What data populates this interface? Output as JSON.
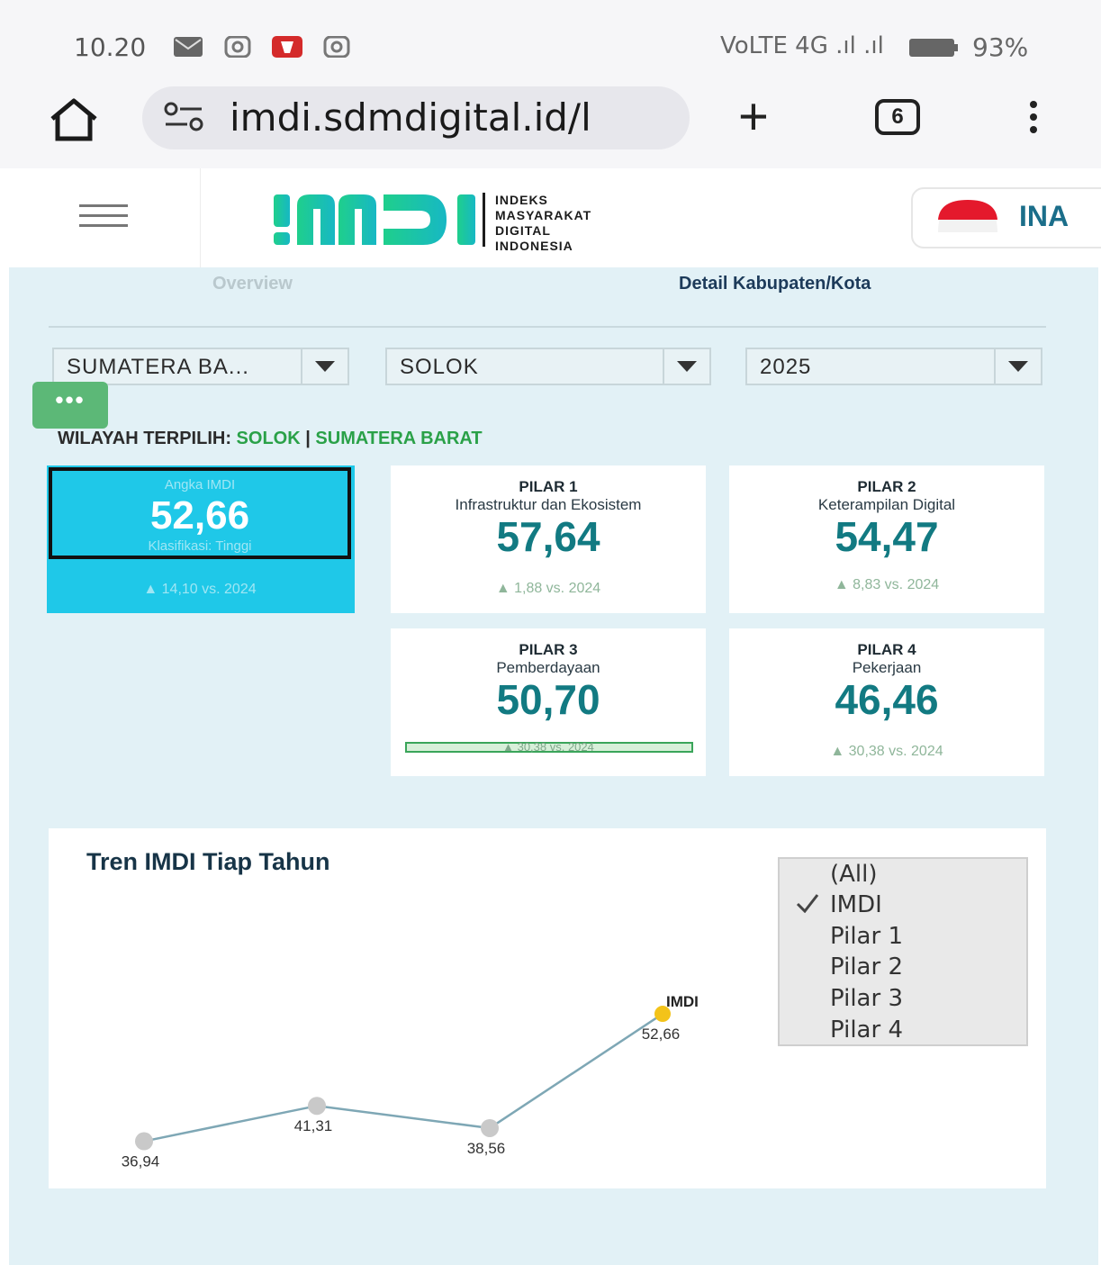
{
  "status_bar": {
    "time": "10.20",
    "signal_text": "VoLTE 4G .ıl .ıl",
    "battery_percent": "93%",
    "icons": [
      "mail-icon",
      "instagram-icon",
      "app-notification-icon",
      "instagram-icon",
      "volte-icon",
      "signal-icon",
      "battery-icon"
    ]
  },
  "browser": {
    "url": "imdi.sdmdigital.id/l",
    "open_tabs_count": "6",
    "icons": [
      "home-icon",
      "site-settings-icon",
      "new-tab-icon",
      "tabs-icon",
      "menu-icon"
    ]
  },
  "site_header": {
    "logo_text": "IMDI",
    "logo_tagline": [
      "INDEKS",
      "MASYARAKAT",
      "DIGITAL",
      "INDONESIA"
    ],
    "language": "INA",
    "brand_color": "#1ec98a"
  },
  "nav_tabs": {
    "overview": "Overview",
    "detail": "Detail Kabupaten/Kota",
    "active": "detail"
  },
  "filters": {
    "province": "SUMATERA BA...",
    "city": "SOLOK",
    "year": "2025",
    "more_button": "•••"
  },
  "selection": {
    "label": "WILAYAH TERPILIH:",
    "city": "SOLOK",
    "separator": "|",
    "province": "SUMATERA BARAT"
  },
  "imdi_card": {
    "label": "Angka IMDI",
    "value": "52,66",
    "classification": "Klasifikasi: Tinggi",
    "delta": "▲ 14,10 vs. 2024",
    "color": "#1fc8e8"
  },
  "pillars": [
    {
      "title": "PILAR 1",
      "subtitle": "Infrastruktur dan Ekosistem",
      "value": "57,64",
      "delta": "▲ 1,88 vs. 2024"
    },
    {
      "title": "PILAR 2",
      "subtitle": "Keterampilan Digital",
      "value": "54,47",
      "delta": "▲ 8,83 vs. 2024"
    },
    {
      "title": "PILAR 3",
      "subtitle": "Pemberdayaan",
      "value": "50,70",
      "delta": "▲ 30,38 vs. 2024"
    },
    {
      "title": "PILAR 4",
      "subtitle": "Pekerjaan",
      "value": "46,46",
      "delta": "▲ 30,38 vs. 2024"
    }
  ],
  "trend_chart": {
    "title": "Tren IMDI Tiap Tahun",
    "filter_options": [
      "(All)",
      "IMDI",
      "Pilar 1",
      "Pilar 2",
      "Pilar 3",
      "Pilar 4"
    ],
    "filter_checked": "IMDI"
  },
  "chart_data": {
    "type": "line",
    "title": "Tren IMDI Tiap Tahun",
    "series": [
      {
        "name": "IMDI",
        "values": [
          36.94,
          41.31,
          38.56,
          52.66
        ],
        "labels": [
          "36,94",
          "41,31",
          "38,56",
          "52,66"
        ]
      }
    ],
    "point_color": "#c9c9c9",
    "highlight_color": "#f3c319",
    "line_color": "#7ea7b5",
    "grid": false,
    "legend": "right"
  }
}
